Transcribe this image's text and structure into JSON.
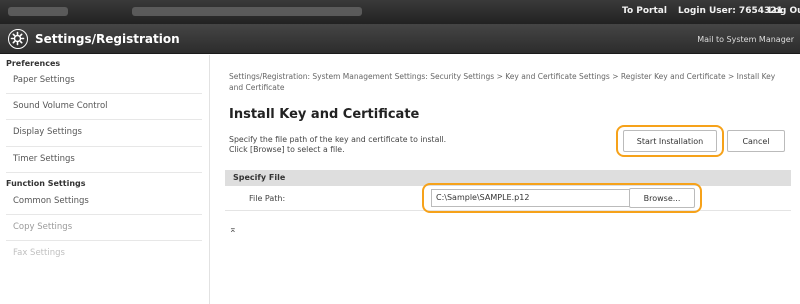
{
  "topbar": {
    "to_portal": "To Portal",
    "login_user": "Login User: 7654321",
    "log_out": "Log Out"
  },
  "header": {
    "title": "Settings/Registration",
    "mail": "Mail to System Manager"
  },
  "sidebar": {
    "preferences_heading": "Preferences",
    "preferences_items": [
      "Paper Settings",
      "Sound Volume Control",
      "Display Settings",
      "Timer Settings"
    ],
    "function_heading": "Function Settings",
    "function_items": [
      "Common Settings",
      "Copy Settings",
      "Fax Settings"
    ]
  },
  "main": {
    "breadcrumb": "Settings/Registration: System Management Settings: Security Settings > Key and Certificate Settings > Register Key and Certificate > Install Key and Certificate",
    "title": "Install Key and Certificate",
    "desc_line1": "Specify the file path of the key and certificate to install.",
    "desc_line2": "Click [Browse] to select a file.",
    "start_label": "Start Installation",
    "cancel_label": "Cancel",
    "section_title": "Specify File",
    "field_label": "File Path:",
    "file_path_value": "C:\\Sample\\SAMPLE.p12",
    "browse_label": "Browse...",
    "to_top": "⌅"
  },
  "colors": {
    "highlight": "#f6a21a",
    "topbar_bg": "#2a2a2a"
  }
}
